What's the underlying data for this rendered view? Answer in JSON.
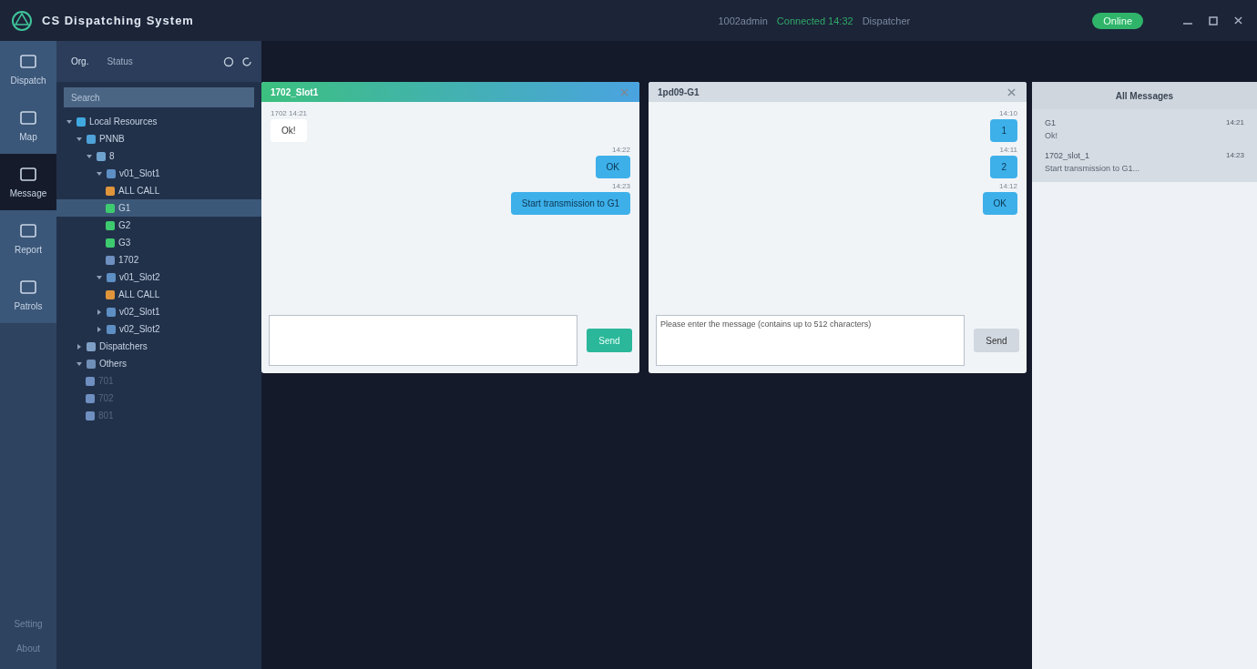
{
  "window": {
    "title": "CS Dispatching System"
  },
  "header": {
    "user_info": "1002admin",
    "connection": "Connected 14:32",
    "account": "Dispatcher",
    "status": "Online"
  },
  "nav": {
    "items": [
      {
        "label": "Dispatch",
        "selected": false
      },
      {
        "label": "Map",
        "selected": false
      },
      {
        "label": "Message",
        "selected": true
      },
      {
        "label": "Report",
        "selected": false
      },
      {
        "label": "Patrols",
        "selected": false
      }
    ],
    "bottom": [
      "Setting",
      "About"
    ]
  },
  "tree_panel": {
    "tabs": [
      {
        "label": "Org.",
        "selected": true
      },
      {
        "label": "Status",
        "selected": false
      }
    ],
    "search": {
      "placeholder": "Search"
    },
    "tree": [
      {
        "label": "Local Resources",
        "kind": "root",
        "expanded": true,
        "selected": false,
        "disabled": false,
        "children": [
          {
            "label": "PNNB",
            "kind": "site",
            "expanded": true,
            "selected": false,
            "disabled": false,
            "children": [
              {
                "label": "8",
                "kind": "node",
                "expanded": true,
                "selected": false,
                "disabled": false,
                "children": [
                  {
                    "label": "v01_Slot1",
                    "kind": "slot",
                    "expanded": true,
                    "selected": false,
                    "disabled": false,
                    "children": [
                      {
                        "label": "ALL CALL",
                        "kind": "allcall",
                        "selected": false,
                        "disabled": false
                      },
                      {
                        "label": "G1",
                        "kind": "group",
                        "selected": true,
                        "disabled": false
                      },
                      {
                        "label": "G2",
                        "kind": "group",
                        "selected": false,
                        "disabled": false
                      },
                      {
                        "label": "G3",
                        "kind": "group",
                        "selected": false,
                        "disabled": false
                      },
                      {
                        "label": "1702",
                        "kind": "radio",
                        "selected": false,
                        "disabled": false
                      }
                    ]
                  },
                  {
                    "label": "v01_Slot2",
                    "kind": "slot",
                    "expanded": true,
                    "selected": false,
                    "disabled": false,
                    "children": [
                      {
                        "label": "ALL CALL",
                        "kind": "allcall",
                        "selected": false,
                        "disabled": false
                      }
                    ]
                  },
                  {
                    "label": "v02_Slot1",
                    "kind": "slot",
                    "expanded": false,
                    "selected": false,
                    "disabled": false
                  },
                  {
                    "label": "v02_Slot2",
                    "kind": "slot",
                    "expanded": false,
                    "selected": false,
                    "disabled": false
                  }
                ]
              }
            ]
          },
          {
            "label": "Dispatchers",
            "kind": "dispatcher",
            "expanded": false,
            "selected": false,
            "disabled": false
          },
          {
            "label": "Others",
            "kind": "others",
            "expanded": true,
            "selected": false,
            "disabled": false,
            "children": [
              {
                "label": "701",
                "kind": "radio",
                "selected": false,
                "disabled": true
              },
              {
                "label": "702",
                "kind": "radio",
                "selected": false,
                "disabled": true
              },
              {
                "label": "801",
                "kind": "radio",
                "selected": false,
                "disabled": true
              }
            ]
          }
        ]
      }
    ]
  },
  "chats": [
    {
      "title": "1702_Slot1",
      "active": true,
      "messages": [
        {
          "sender": "1702",
          "time": "14:21",
          "text": "Ok!",
          "outgoing": false
        },
        {
          "time": "14:22",
          "text": "OK",
          "outgoing": true
        },
        {
          "time": "14:23",
          "text": "Start transmission to G1",
          "outgoing": true
        }
      ],
      "send": "Send"
    },
    {
      "title": "1pd09-G1",
      "active": false,
      "messages": [
        {
          "time": "14:10",
          "text": "1",
          "outgoing": true
        },
        {
          "time": "14:11",
          "text": "2",
          "outgoing": true
        },
        {
          "time": "14:12",
          "text": "OK",
          "outgoing": true
        }
      ],
      "input": {
        "placeholder": "Please enter the message (contains up to 512 characters)"
      },
      "send": "Send"
    }
  ],
  "all_messages": {
    "title": "All Messages",
    "items": [
      {
        "name": "G1",
        "preview": "Ok!",
        "time": "14:21"
      },
      {
        "name": "1702_slot_1",
        "preview": "Start transmission to G1...",
        "time": "14:23"
      }
    ]
  }
}
